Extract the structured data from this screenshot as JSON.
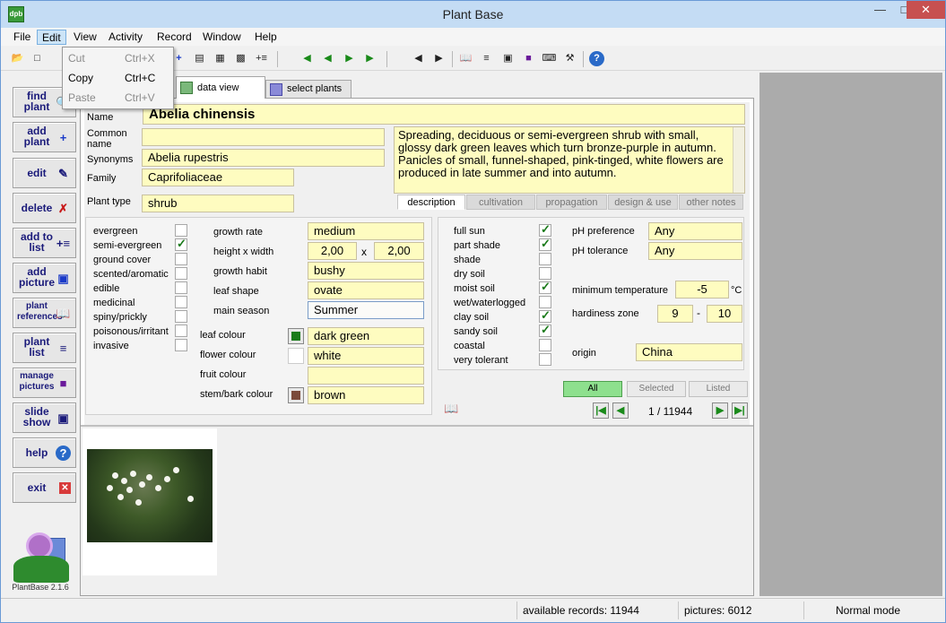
{
  "window": {
    "title": "Plant Base",
    "icon": "dpb",
    "min": "—",
    "max": "□",
    "close": "✕"
  },
  "menu": [
    "File",
    "Edit",
    "View",
    "Activity",
    "Record",
    "Window",
    "Help"
  ],
  "edit_menu": [
    {
      "label": "Cut",
      "shortcut": "Ctrl+X",
      "enabled": false
    },
    {
      "label": "Copy",
      "shortcut": "Ctrl+C",
      "enabled": true
    },
    {
      "label": "Paste",
      "shortcut": "Ctrl+V",
      "enabled": false
    }
  ],
  "toolbar_icons": [
    "open-icon",
    "new-icon",
    "add-icon",
    "save-icon",
    "save-as-icon",
    "add-to-list-icon",
    "first-record-icon",
    "previous-record-icon",
    "next-record-icon",
    "last-record-icon",
    "back-icon",
    "forward-icon",
    "book-icon",
    "list-icon",
    "slideshow-icon",
    "picture-icon",
    "print-icon",
    "tools-icon",
    "help-icon"
  ],
  "left_buttons": [
    {
      "label": "find plant",
      "icon": "find-icon"
    },
    {
      "label": "add plant",
      "icon": "add-plant-icon"
    },
    {
      "label": "edit",
      "icon": "edit-icon"
    },
    {
      "label": "delete",
      "icon": "delete-icon"
    },
    {
      "label": "add to list",
      "icon": "add-to-list-icon"
    },
    {
      "label": "add picture",
      "icon": "add-picture-icon"
    },
    {
      "label": "plant references",
      "icon": "references-icon"
    },
    {
      "label": "plant list",
      "icon": "plant-list-icon"
    },
    {
      "label": "manage pictures",
      "icon": "manage-pictures-icon"
    },
    {
      "label": "slide show",
      "icon": "slideshow-icon"
    },
    {
      "label": "help",
      "icon": "help-icon"
    },
    {
      "label": "exit",
      "icon": "exit-icon"
    }
  ],
  "logo_label": "PlantBase 2.1.6",
  "tabs": [
    "data view",
    "select plants"
  ],
  "plant": {
    "name_label": "Name",
    "name": "Abelia chinensis",
    "common_label": "Common name",
    "common_name": "",
    "synonyms_label": "Synonyms",
    "synonyms": "Abelia rupestris",
    "family_label": "Family",
    "family": "Caprifoliaceae",
    "type_label": "Plant type",
    "type": "shrub",
    "description": "Spreading, deciduous or semi-evergreen shrub with small, glossy dark green leaves which turn bronze-purple in autumn. Panicles of small, funnel-shaped, pink-tinged, white flowers are produced in late summer and into autumn."
  },
  "desc_tabs": [
    "description",
    "cultivation",
    "propagation",
    "design & use",
    "other notes"
  ],
  "characteristics": [
    {
      "label": "evergreen",
      "checked": false
    },
    {
      "label": "semi-evergreen",
      "checked": true
    },
    {
      "label": "ground cover",
      "checked": false
    },
    {
      "label": "scented/aromatic",
      "checked": false
    },
    {
      "label": "edible",
      "checked": false
    },
    {
      "label": "medicinal",
      "checked": false
    },
    {
      "label": "spiny/prickly",
      "checked": false
    },
    {
      "label": "poisonous/irritant",
      "checked": false
    },
    {
      "label": "invasive",
      "checked": false
    }
  ],
  "growth": {
    "rate_label": "growth rate",
    "rate": "medium",
    "size_label": "height x width",
    "height": "2,00",
    "x": "x",
    "width": "2,00",
    "habit_label": "growth habit",
    "habit": "bushy",
    "leaf_shape_label": "leaf shape",
    "leaf_shape": "ovate",
    "season_label": "main season",
    "season": "Summer"
  },
  "colours": [
    {
      "label": "leaf colour",
      "value": "dark green",
      "swatch": "#1a7a1a"
    },
    {
      "label": "flower colour",
      "value": "white",
      "swatch": "#ffffff"
    },
    {
      "label": "fruit colour",
      "value": "",
      "swatch": ""
    },
    {
      "label": "stem/bark colour",
      "value": "brown",
      "swatch": "#7a4a3a"
    }
  ],
  "conditions": [
    {
      "label": "full sun",
      "checked": true
    },
    {
      "label": "part shade",
      "checked": true
    },
    {
      "label": "shade",
      "checked": false
    },
    {
      "label": "dry soil",
      "checked": false
    },
    {
      "label": "moist soil",
      "checked": true
    },
    {
      "label": "wet/waterlogged",
      "checked": false
    },
    {
      "label": "clay soil",
      "checked": true
    },
    {
      "label": "sandy soil",
      "checked": true
    },
    {
      "label": "coastal",
      "checked": false
    },
    {
      "label": "very tolerant",
      "checked": false
    }
  ],
  "ph": {
    "pref_label": "pH preference",
    "pref": "Any",
    "tol_label": "pH tolerance",
    "tol": "Any"
  },
  "temp": {
    "label": "minimum temperature",
    "value": "-5",
    "unit": "°C"
  },
  "hardiness": {
    "label": "hardiness zone",
    "from": "9",
    "dash": "-",
    "to": "10"
  },
  "origin": {
    "label": "origin",
    "value": "China"
  },
  "filters": [
    "All",
    "Selected",
    "Listed"
  ],
  "record_nav": "1 / 11944",
  "status": {
    "records": "available records: 11944",
    "pictures": "pictures: 6012",
    "mode": "Normal mode"
  },
  "colors": {
    "field_bg": "#fefcc0",
    "title_bg": "#c4dcf4",
    "accent_green": "#1a8a1a"
  }
}
